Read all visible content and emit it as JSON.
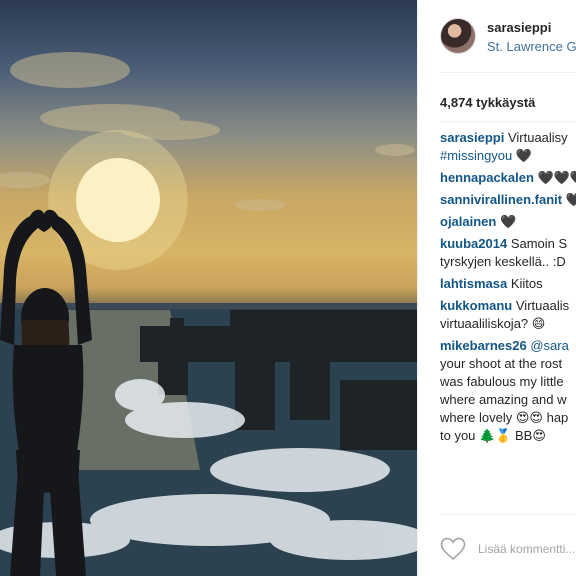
{
  "post": {
    "username": "sarasieppi",
    "location": "St. Lawrence G",
    "likes": "4,874 tykkäystä"
  },
  "comments": [
    {
      "user": "sarasieppi",
      "lines": [
        "Virtuaalisy"
      ],
      "tag": "#missingyou",
      "tag_suffix": " 🖤"
    },
    {
      "user": "hennapackalen",
      "lines": [
        "🖤🖤🖤"
      ]
    },
    {
      "user": "sannivirallinen.fanit",
      "lines": [
        "🖤"
      ]
    },
    {
      "user": "ojalainen",
      "lines": [
        "🖤"
      ]
    },
    {
      "user": "kuuba2014",
      "lines": [
        "Samoin S",
        "tyrskyjen keskellä.. :D"
      ]
    },
    {
      "user": "lahtismasa",
      "lines": [
        "Kiitos"
      ]
    },
    {
      "user": "kukkomanu",
      "lines": [
        "Virtuaalis",
        "virtuaaliliskoja? 😄"
      ]
    },
    {
      "user": "mikebarnes26",
      "lines": [
        "@sara",
        "your shoot at the rost",
        "was fabulous my little",
        "where amazing and w",
        "where lovely 😍😍 hap",
        "to you 🌲🥇 BB😍"
      ]
    }
  ],
  "footer": {
    "comment_placeholder": "Lisää kommentti..."
  }
}
